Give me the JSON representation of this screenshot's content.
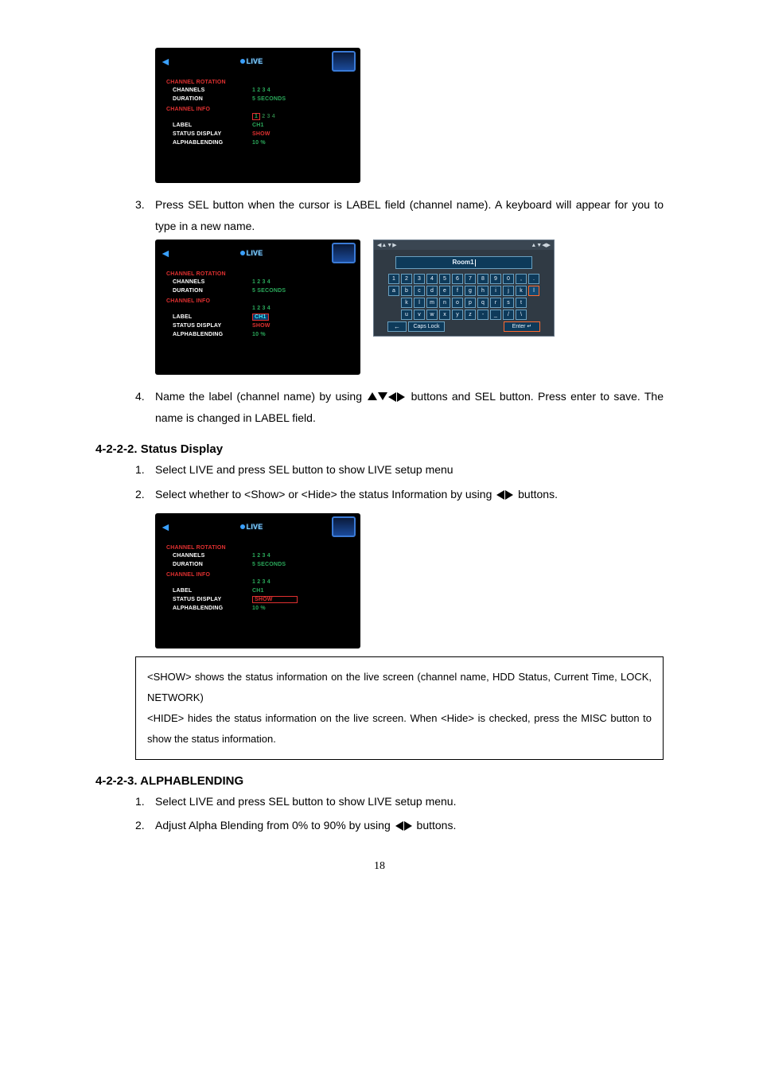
{
  "setup_menu": {
    "title": "LIVE",
    "section1": "CHANNEL ROTATION",
    "channels_label": "CHANNELS",
    "channels_value": "1  2  3  4",
    "duration_label": "DURATION",
    "duration_value": "5 SECONDS",
    "section2": "CHANNEL INFO",
    "channel_info_value_boxed": "1",
    "channel_info_value_rest": "2  3  4",
    "label_label": "LABEL",
    "label_value": "CH1",
    "status_label": "STATUS DISPLAY",
    "status_value": "SHOW",
    "alpha_label": "ALPHABLENDING",
    "alpha_value": "10 %"
  },
  "keyboard": {
    "topbar_left": "◀▲▼▶",
    "topbar_right": "▲▼◀▶",
    "field_text": "Room1",
    "row1": [
      "1",
      "2",
      "3",
      "4",
      "5",
      "6",
      "7",
      "8",
      "9",
      "0",
      ",",
      "."
    ],
    "row2": [
      "a",
      "b",
      "c",
      "d",
      "e",
      "f",
      "g",
      "h",
      "i",
      "j",
      "k",
      "l"
    ],
    "row3": [
      "k",
      "l",
      "m",
      "n",
      "o",
      "p",
      "q",
      "r",
      "s",
      "t"
    ],
    "row4": [
      "u",
      "v",
      "w",
      "x",
      "y",
      "z",
      "-",
      "_",
      "/",
      "\\"
    ],
    "back_key": "←",
    "caps_key": "Caps Lock",
    "enter_key": "Enter ↵"
  },
  "step3": {
    "num": "3.",
    "text": "Press SEL button when the cursor is LABEL field (channel name).  A keyboard will appear for you to type in a new name."
  },
  "step4": {
    "num": "4.",
    "text_a": "Name the label (channel name) by using ",
    "text_b": " buttons and SEL button. Press enter to save. The name is changed in LABEL field."
  },
  "heading_status": "4-2-2-2. Status Display",
  "status_step1": {
    "num": "1.",
    "text": "Select LIVE and press SEL button to show LIVE setup menu"
  },
  "status_step2": {
    "num": "2.",
    "text_a": "Select whether to <Show> or <Hide> the status Information by using ",
    "text_b": " buttons."
  },
  "note": {
    "line1": "<SHOW> shows the status information on the live screen (channel name, HDD Status, Current Time, LOCK, NETWORK)",
    "line2": "<HIDE> hides the status information on the live screen. When <Hide> is checked, press the MISC button to show the status information."
  },
  "heading_alpha": "4-2-2-3. ALPHABLENDING",
  "alpha_step1": {
    "num": "1.",
    "text": "Select LIVE and press SEL button to show LIVE setup menu."
  },
  "alpha_step2": {
    "num": "2.",
    "text_a": "Adjust Alpha Blending from 0% to 90% by using ",
    "text_b": " buttons."
  },
  "page_number": "18"
}
